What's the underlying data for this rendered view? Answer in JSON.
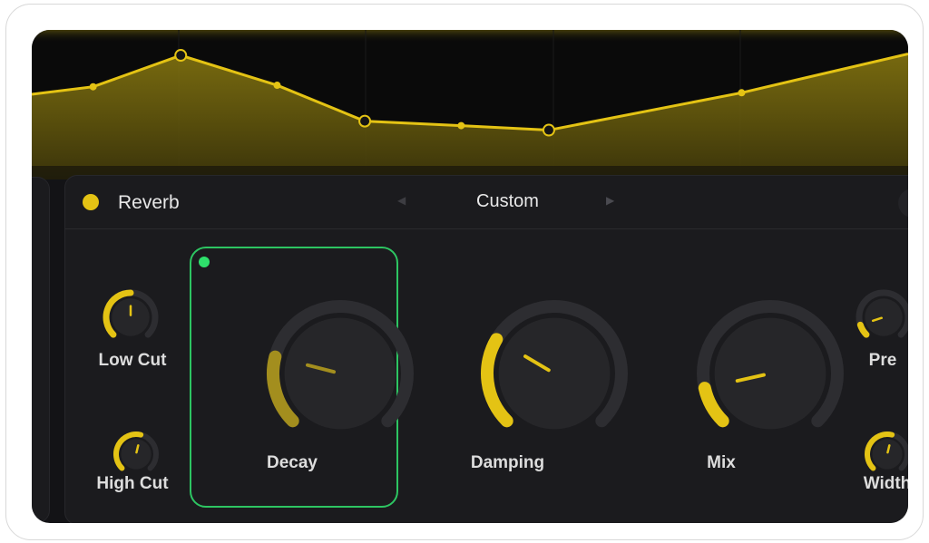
{
  "colors": {
    "accent": "#e4c314",
    "accent_dim": "#a38e1e",
    "selection": "#2dc562",
    "background": "#131316",
    "panel": "#1b1b1e"
  },
  "module": {
    "title": "Reverb",
    "enabled": true,
    "preset": {
      "name": "Custom",
      "prev_icon": "chevron-left-icon",
      "next_icon": "chevron-right-icon"
    }
  },
  "envelope": {
    "points": [
      {
        "x": 0.0,
        "y": 0.43
      },
      {
        "x": 0.07,
        "y": 0.38
      },
      {
        "x": 0.17,
        "y": 0.17
      },
      {
        "x": 0.28,
        "y": 0.37
      },
      {
        "x": 0.38,
        "y": 0.61
      },
      {
        "x": 0.49,
        "y": 0.64
      },
      {
        "x": 0.59,
        "y": 0.67
      },
      {
        "x": 0.81,
        "y": 0.42
      },
      {
        "x": 1.0,
        "y": 0.16
      }
    ]
  },
  "knobs": {
    "low_cut": {
      "label": "Low Cut",
      "level": 0.5
    },
    "high_cut": {
      "label": "High Cut",
      "level": 0.55
    },
    "decay": {
      "label": "Decay",
      "level": 0.22,
      "selected": true
    },
    "damping": {
      "label": "Damping",
      "level": 0.28
    },
    "mix": {
      "label": "Mix",
      "level": 0.12
    },
    "pre": {
      "label": "Pre",
      "level": 0.1
    },
    "width": {
      "label": "Width",
      "level": 0.55
    }
  }
}
